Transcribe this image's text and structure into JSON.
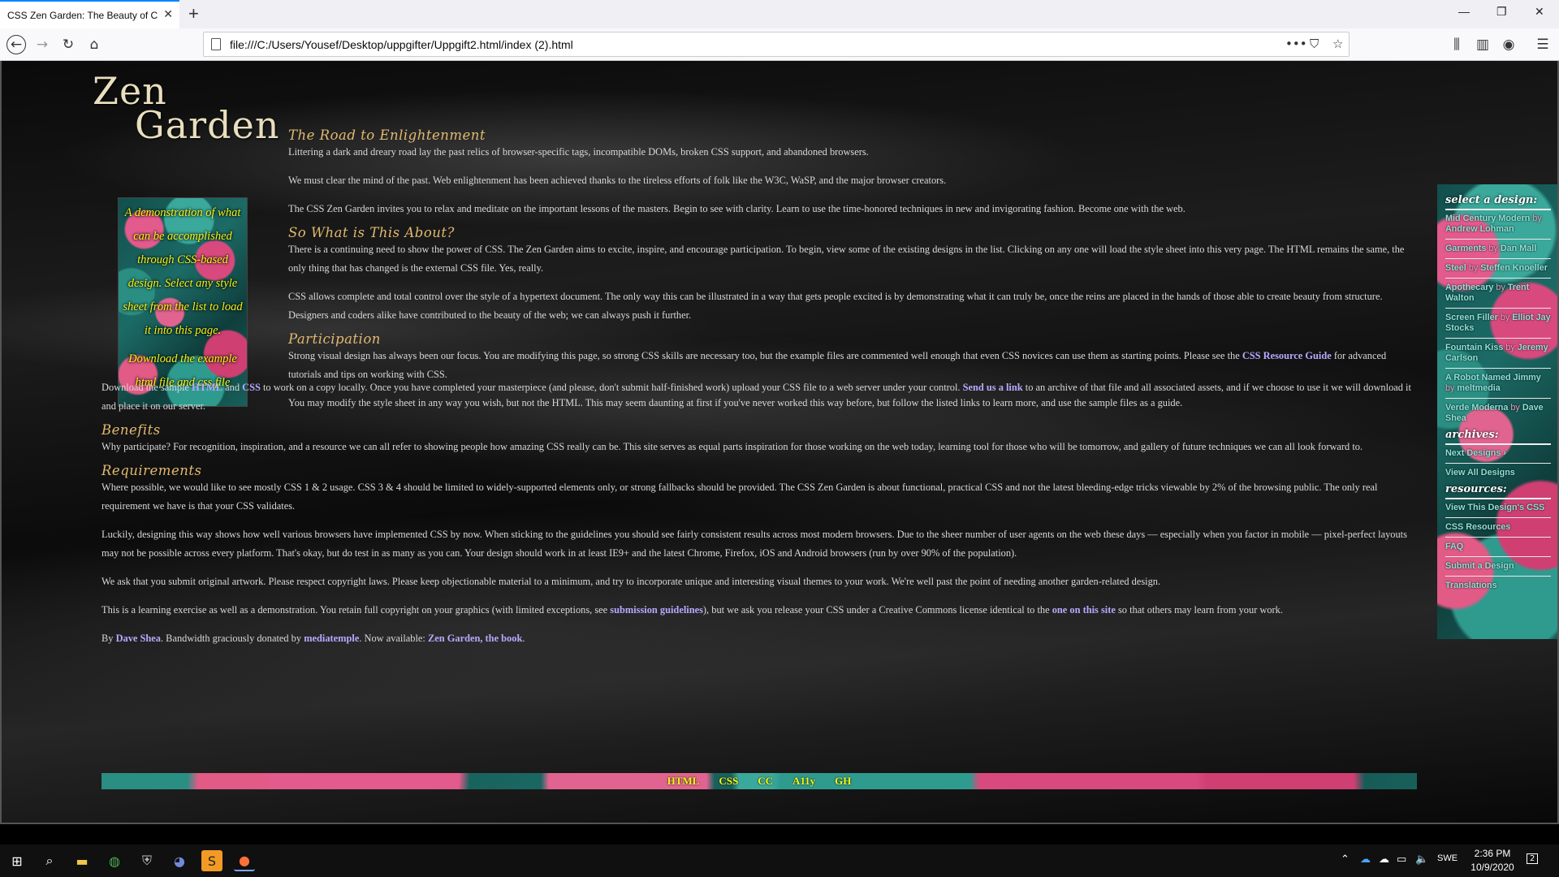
{
  "browser": {
    "tab_title": "CSS Zen Garden: The Beauty of CSS Design",
    "tab_close": "✕",
    "new_tab": "+",
    "url": "file:///C:/Users/Yousef/Desktop/uppgifter/Uppgift2.html/index (2).html",
    "url_more": "•••",
    "win_min": "—",
    "win_max": "❐",
    "win_close": "✕"
  },
  "logo": {
    "line1": "Zen",
    "line2": "Garden"
  },
  "preamble_box": {
    "text": "A demonstration of what can be accomplished through CSS-based design. Select any style sheet from the list to load it into this page.",
    "download": "Download the example html file and css file"
  },
  "sections": {
    "road": {
      "heading": "The Road to Enlightenment",
      "p1": "Littering a dark and dreary road lay the past relics of browser-specific tags, incompatible DOMs, broken CSS support, and abandoned browsers.",
      "p2": "We must clear the mind of the past. Web enlightenment has been achieved thanks to the tireless efforts of folk like the W3C, WaSP, and the major browser creators.",
      "p3": "The CSS Zen Garden invites you to relax and meditate on the important lessons of the masters. Begin to see with clarity. Learn to use the time-honored techniques in new and invigorating fashion. Become one with the web."
    },
    "about": {
      "heading": "So What is This About?",
      "p1": "There is a continuing need to show the power of CSS. The Zen Garden aims to excite, inspire, and encourage participation. To begin, view some of the existing designs in the list. Clicking on any one will load the style sheet into this very page. The HTML remains the same, the only thing that has changed is the external CSS file. Yes, really.",
      "p2": "CSS allows complete and total control over the style of a hypertext document. The only way this can be illustrated in a way that gets people excited is by demonstrating what it can truly be, once the reins are placed in the hands of those able to create beauty from structure. Designers and coders alike have contributed to the beauty of the web; we can always push it further."
    },
    "participation": {
      "heading": "Participation",
      "p1a": "Strong visual design has always been our focus. You are modifying this page, so strong CSS skills are necessary too, but the example files are commented well enough that even CSS novices can use them as starting points. Please see the ",
      "p1_link": "CSS Resource Guide",
      "p1b": " for advanced tutorials and tips on working with CSS.",
      "p2": "You may modify the style sheet in any way you wish, but not the HTML. This may seem daunting at first if you've never worked this way before, but follow the listed links to learn more, and use the sample files as a guide.",
      "p3a": "Download the sample ",
      "p3_link1": "HTML",
      "p3_and": " and ",
      "p3_link2": "CSS",
      "p3b": " to work on a copy locally. Once you have completed your masterpiece (and please, don't submit half-finished work) upload your CSS file to a web server under your control. ",
      "p3_link3": "Send us a link",
      "p3c": " to an archive of that file and all associated assets, and if we choose to use it we will download it and place it on our server."
    },
    "benefits": {
      "heading": "Benefits",
      "p1": "Why participate? For recognition, inspiration, and a resource we can all refer to showing people how amazing CSS really can be. This site serves as equal parts inspiration for those working on the web today, learning tool for those who will be tomorrow, and gallery of future techniques we can all look forward to."
    },
    "requirements": {
      "heading": "Requirements",
      "p1": "Where possible, we would like to see mostly CSS 1 & 2 usage. CSS 3 & 4 should be limited to widely-supported elements only, or strong fallbacks should be provided. The CSS Zen Garden is about functional, practical CSS and not the latest bleeding-edge tricks viewable by 2% of the browsing public. The only real requirement we have is that your CSS validates.",
      "p2": "Luckily, designing this way shows how well various browsers have implemented CSS by now. When sticking to the guidelines you should see fairly consistent results across most modern browsers. Due to the sheer number of user agents on the web these days — especially when you factor in mobile — pixel-perfect layouts may not be possible across every platform. That's okay, but do test in as many as you can. Your design should work in at least IE9+ and the latest Chrome, Firefox, iOS and Android browsers (run by over 90% of the population).",
      "p3": "We ask that you submit original artwork. Please respect copyright laws. Please keep objectionable material to a minimum, and try to incorporate unique and interesting visual themes to your work. We're well past the point of needing another garden-related design.",
      "p4a": "This is a learning exercise as well as a demonstration. You retain full copyright on your graphics (with limited exceptions, see ",
      "p4_link1": "submission guidelines",
      "p4b": "), but we ask you release your CSS under a Creative Commons license identical to the ",
      "p4_link2": "one on this site",
      "p4c": " so that others may learn from your work.",
      "p5a": "By ",
      "p5_link1": "Dave Shea",
      "p5b": ". Bandwidth graciously donated by ",
      "p5_link2": "mediatemple",
      "p5c": ". Now available: ",
      "p5_link3": "Zen Garden, the book",
      "p5d": "."
    }
  },
  "sidebar": {
    "select_heading": "select a design:",
    "designs": [
      {
        "name": "Mid Century Modern",
        "by": "by",
        "author": "Andrew Lohman"
      },
      {
        "name": "Garments",
        "by": "by",
        "author": "Dan Mall"
      },
      {
        "name": "Steel",
        "by": "by",
        "author": "Steffen Knoeller"
      },
      {
        "name": "Apothecary",
        "by": "by",
        "author": "Trent Walton"
      },
      {
        "name": "Screen Filler",
        "by": "by",
        "author": "Elliot Jay Stocks"
      },
      {
        "name": "Fountain Kiss",
        "by": "by",
        "author": "Jeremy Carlson"
      },
      {
        "name": "A Robot Named Jimmy",
        "by": "by",
        "author": "meltmedia"
      },
      {
        "name": "Verde Moderna",
        "by": "by",
        "author": "Dave Shea"
      }
    ],
    "archives_heading": "archives:",
    "archives": [
      "Next Designs ›",
      "View All Designs"
    ],
    "resources_heading": "resources:",
    "resources": [
      "View This Design's CSS",
      "CSS Resources",
      "FAQ",
      "Submit a Design",
      "Translations"
    ]
  },
  "footer": [
    "HTML",
    "CSS",
    "CC",
    "A11y",
    "GH"
  ],
  "taskbar": {
    "time": "2:36 PM",
    "date": "10/9/2020",
    "lang": "SWE",
    "notif": "2"
  }
}
